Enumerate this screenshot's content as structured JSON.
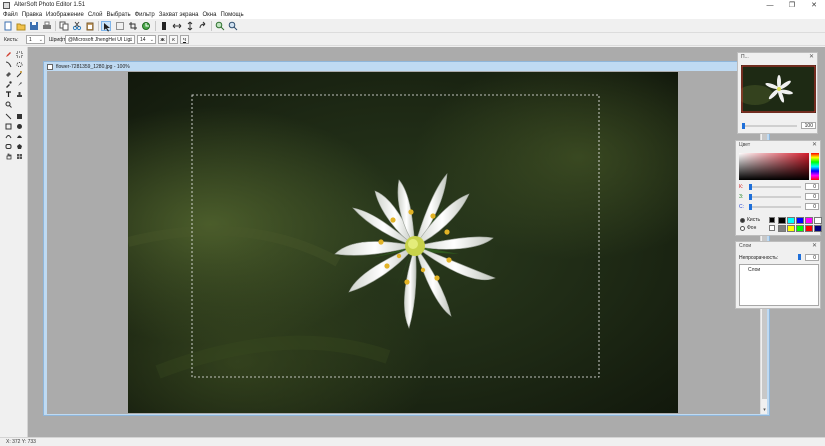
{
  "window": {
    "title": "AlterSoft Photo Editor 1.51",
    "minimize_glyph": "—",
    "maximize_glyph": "❐",
    "close_glyph": "✕"
  },
  "menu": [
    "Файл",
    "Правка",
    "Изображение",
    "Слой",
    "Выбрать",
    "Фильтр",
    "Захват экрана",
    "Окна",
    "Помощь"
  ],
  "toolbar": {
    "icons": [
      "new-icon",
      "open-icon",
      "save-icon",
      "print-icon",
      "copy-icon",
      "cut-icon",
      "paste-icon",
      "pointer-icon",
      "select-rect-icon",
      "crop-icon",
      "rotate-icon",
      "flip-icon",
      "flip-h-icon",
      "flip-v-icon",
      "redo-icon",
      "zoom-in-icon",
      "zoom-out-icon"
    ]
  },
  "options_bar": {
    "brush_label": "Кисть:",
    "brush_size": "1",
    "font_label": "Шрифт:",
    "font_name": "@Microsoft JhengHei UI Ligt",
    "font_size": "14",
    "bold": "ж",
    "italic": "к",
    "underline": "ч"
  },
  "document": {
    "title": "flower-7281359_1280.jpg - 100%",
    "restore_glyph": "▭ ▫ ✕"
  },
  "navigator": {
    "title": "П...",
    "zoom_value": "100",
    "zoom_fraction": 0.0
  },
  "color_panel": {
    "title": "Цвет",
    "r_label": "К:",
    "g_label": "З:",
    "b_label": "С:",
    "r_value": "0",
    "g_value": "0",
    "b_value": "0",
    "brush_radio": "Кисть",
    "bg_radio": "Фон",
    "palette": [
      "#000000",
      "#00ffff",
      "#0000ff",
      "#ff00ff",
      "#ffffff",
      "#808080",
      "#ffff00",
      "#00ff00",
      "#ff0000",
      "#000080"
    ]
  },
  "layers_panel": {
    "title": "Слои",
    "opacity_label": "Непрозрачность:",
    "opacity_value": "0",
    "layer_name": "Слои"
  },
  "status": {
    "coords": "X: 372 Y: 733"
  },
  "colors": {
    "accent": "#1e6fd9",
    "doc_frame": "#bfdaf2"
  }
}
